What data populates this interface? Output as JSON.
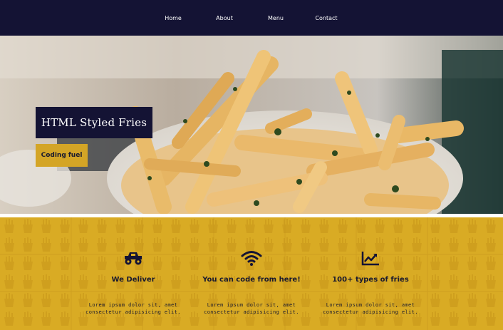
{
  "nav": {
    "items": [
      {
        "label": "Home"
      },
      {
        "label": "About"
      },
      {
        "label": "Menu"
      },
      {
        "label": "Contact"
      }
    ]
  },
  "hero": {
    "title": "HTML Styled Fries",
    "button_label": "Coding fuel"
  },
  "features": [
    {
      "icon": "truck-icon",
      "title": "We Deliver",
      "body": "Lorem ipsum dolor sit, amet consectetur adipisicing elit."
    },
    {
      "icon": "wifi-icon",
      "title": "You can code from here!",
      "body": "Lorem ipsum dolor sit, amet consectetur adipisicing elit."
    },
    {
      "icon": "chart-line-icon",
      "title": "100+ types of fries",
      "body": "Lorem ipsum dolor sit, amet consectetur adipisicing elit."
    }
  ],
  "colors": {
    "nav_bg": "#141334",
    "accent": "#d4a526",
    "features_bg": "#d9ab24"
  }
}
